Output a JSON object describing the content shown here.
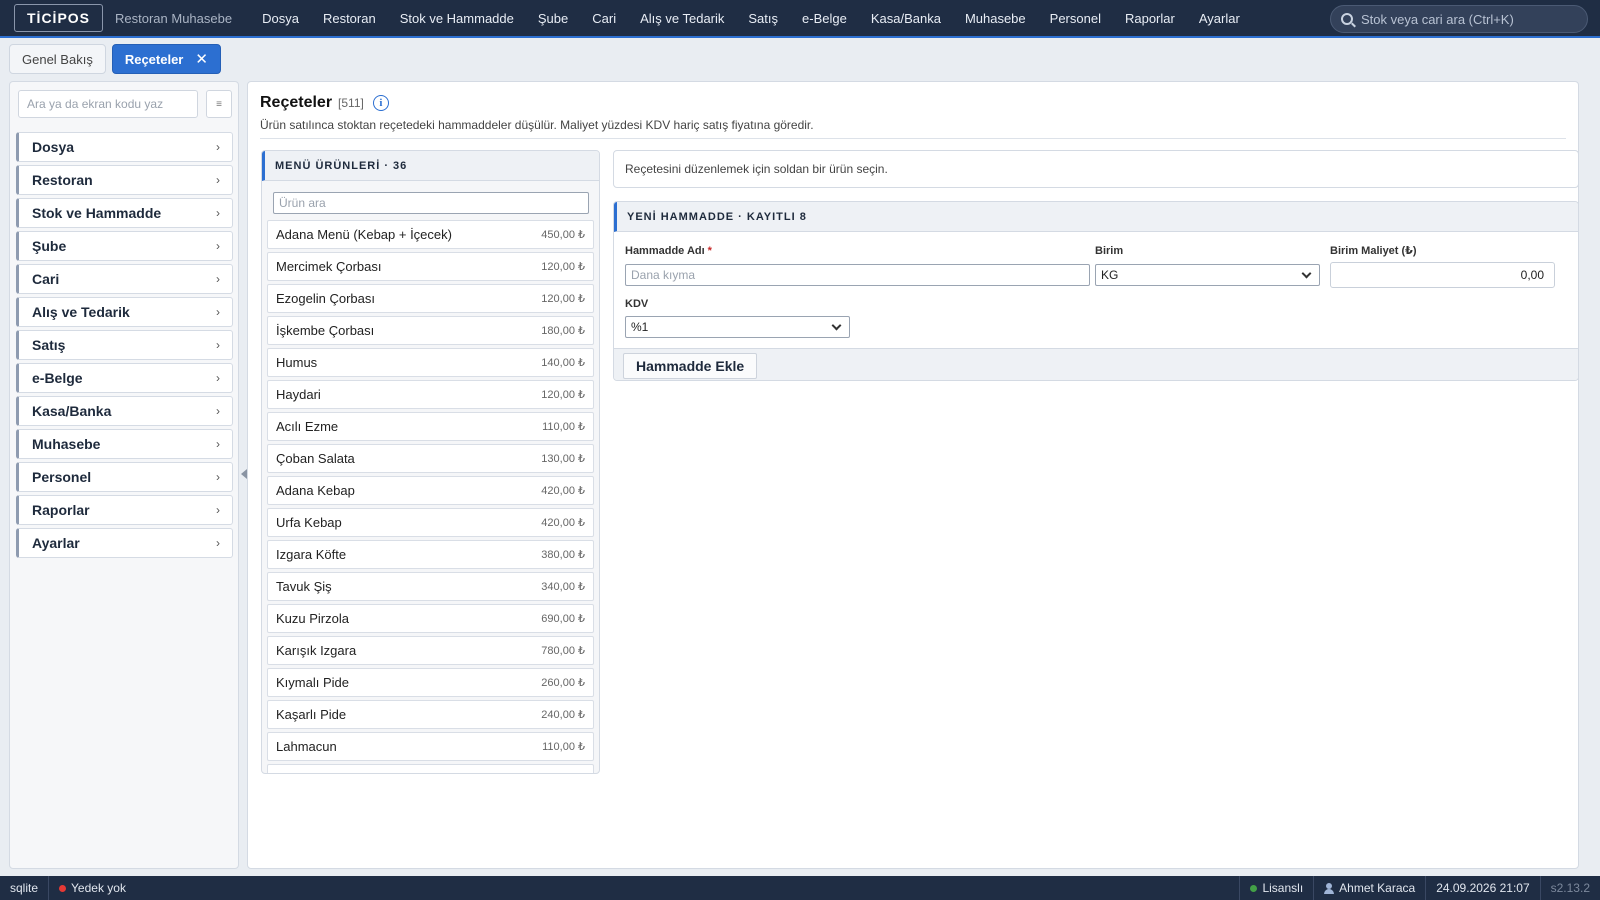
{
  "topbar": {
    "logo": "TİCİPOS",
    "subtitle": "Restoran Muhasebe",
    "nav": [
      "Dosya",
      "Restoran",
      "Stok ve Hammadde",
      "Şube",
      "Cari",
      "Alış ve Tedarik",
      "Satış",
      "e-Belge",
      "Kasa/Banka",
      "Muhasebe",
      "Personel",
      "Raporlar",
      "Ayarlar"
    ],
    "search_placeholder": "Stok veya cari ara (Ctrl+K)"
  },
  "tabs": {
    "overview": "Genel Bakış",
    "active": "Reçeteler",
    "close": "✕"
  },
  "sidebar": {
    "search_placeholder": "Ara ya da ekran kodu yaz",
    "menu_btn": "≡",
    "items": [
      "Dosya",
      "Restoran",
      "Stok ve Hammadde",
      "Şube",
      "Cari",
      "Alış ve Tedarik",
      "Satış",
      "e-Belge",
      "Kasa/Banka",
      "Muhasebe",
      "Personel",
      "Raporlar",
      "Ayarlar"
    ],
    "chevron": "›"
  },
  "page": {
    "title": "Reçeteler",
    "code": "[511]",
    "info": "i",
    "description": "Ürün satılınca stoktan reçetedeki hammaddeler düşülür. Maliyet yüzdesi KDV hariç satış fiyatına göredir."
  },
  "products": {
    "header": "MENÜ ÜRÜNLERİ · 36",
    "search_placeholder": "Ürün ara",
    "items": [
      {
        "name": "Adana Menü (Kebap + İçecek)",
        "price": "450,00 ₺"
      },
      {
        "name": "Mercimek Çorbası",
        "price": "120,00 ₺"
      },
      {
        "name": "Ezogelin Çorbası",
        "price": "120,00 ₺"
      },
      {
        "name": "İşkembe Çorbası",
        "price": "180,00 ₺"
      },
      {
        "name": "Humus",
        "price": "140,00 ₺"
      },
      {
        "name": "Haydari",
        "price": "120,00 ₺"
      },
      {
        "name": "Acılı Ezme",
        "price": "110,00 ₺"
      },
      {
        "name": "Çoban Salata",
        "price": "130,00 ₺"
      },
      {
        "name": "Adana Kebap",
        "price": "420,00 ₺"
      },
      {
        "name": "Urfa Kebap",
        "price": "420,00 ₺"
      },
      {
        "name": "Izgara Köfte",
        "price": "380,00 ₺"
      },
      {
        "name": "Tavuk Şiş",
        "price": "340,00 ₺"
      },
      {
        "name": "Kuzu Pirzola",
        "price": "690,00 ₺"
      },
      {
        "name": "Karışık Izgara",
        "price": "780,00 ₺"
      },
      {
        "name": "Kıymalı Pide",
        "price": "260,00 ₺"
      },
      {
        "name": "Kaşarlı Pide",
        "price": "240,00 ₺"
      },
      {
        "name": "Lahmacun",
        "price": "110,00 ₺"
      }
    ]
  },
  "hint": "Reçetesini düzenlemek için soldan bir ürün seçin.",
  "form": {
    "header": "YENİ HAMMADDE · KAYITLI 8",
    "name_label": "Hammadde Adı",
    "required_mark": "*",
    "name_placeholder": "Dana kıyma",
    "unit_label": "Birim",
    "unit_value": "KG",
    "cost_label": "Birim Maliyet (₺)",
    "cost_value": "0,00",
    "vat_label": "KDV",
    "vat_value": "%1",
    "add_button": "Hammadde Ekle"
  },
  "status": {
    "db": "sqlite",
    "backup": "Yedek yok",
    "license": "Lisanslı",
    "user": "Ahmet Karaca",
    "datetime": "24.09.2026 21:07",
    "version": "s2.13.2"
  },
  "colors": {
    "topbar": "#1f2d44",
    "accent": "#2c6fd1",
    "required": "#c62828",
    "status_red": "#e53935",
    "status_green": "#43a047"
  }
}
